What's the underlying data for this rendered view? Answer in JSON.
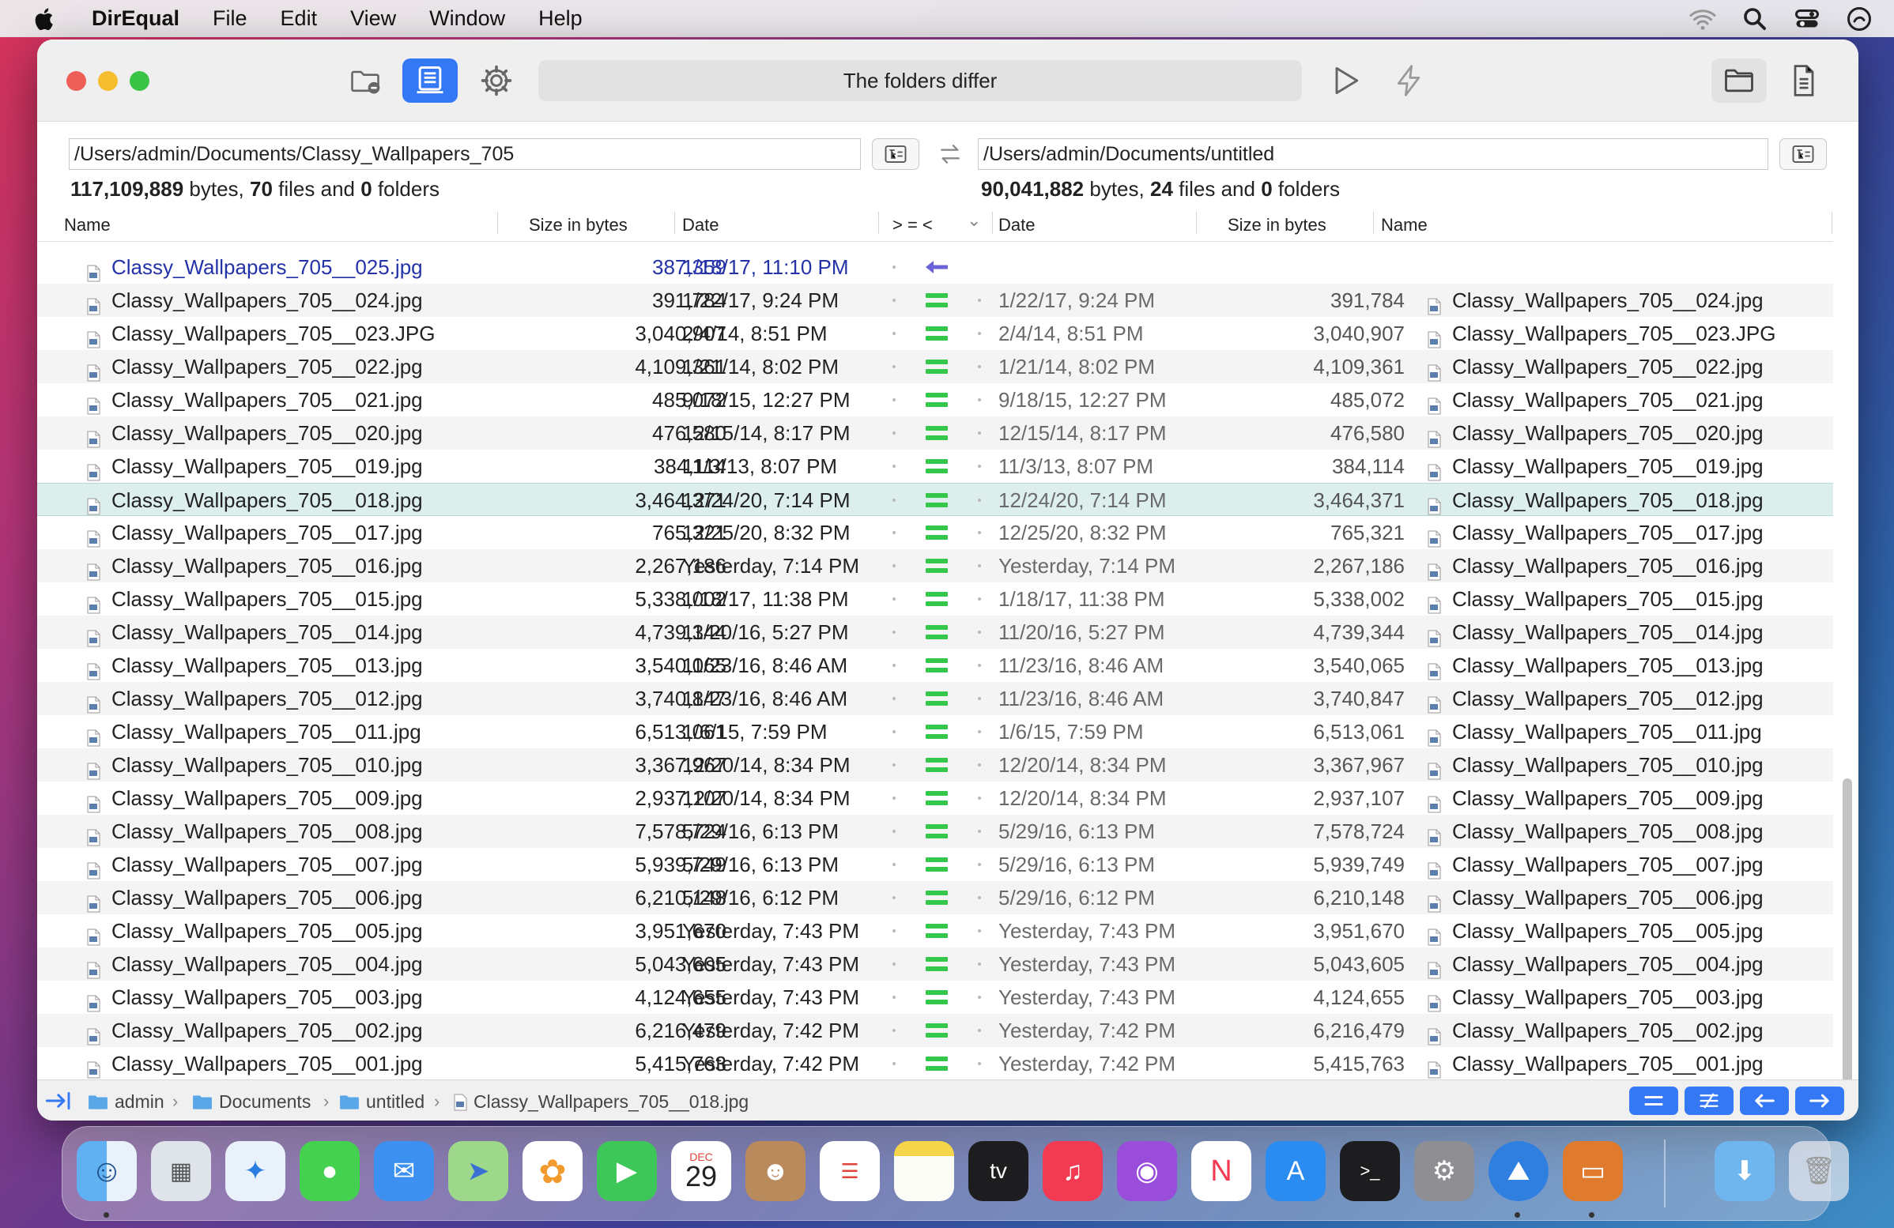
{
  "menubar": {
    "app_name": "DirEqual",
    "items": [
      "File",
      "Edit",
      "View",
      "Window",
      "Help"
    ]
  },
  "toolbar": {
    "status_text": "The folders differ"
  },
  "left": {
    "path": "/Users/admin/Documents/Classy_Wallpapers_705",
    "bytes": "117,109,889",
    "files": "70",
    "folders": "0"
  },
  "right": {
    "path": "/Users/admin/Documents/untitled",
    "bytes": "90,041,882",
    "files": "24",
    "folders": "0"
  },
  "summary_words": {
    "bytes": "bytes,",
    "files_and": "files and",
    "folders": "folders"
  },
  "columns": {
    "name": "Name",
    "size": "Size in bytes",
    "date": "Date",
    "compare": "> = <",
    "rdate": "Date",
    "rsize": "Size in bytes",
    "rname": "Name"
  },
  "rows": [
    {
      "name": "Classy_Wallpapers_705__025.jpg",
      "size": "387,359",
      "date": "1/18/17, 11:10 PM",
      "status": "left-only",
      "rdate": "",
      "rsize": "",
      "rname": ""
    },
    {
      "name": "Classy_Wallpapers_705__024.jpg",
      "size": "391,784",
      "date": "1/22/17, 9:24 PM",
      "status": "equal",
      "rdate": "1/22/17, 9:24 PM",
      "rsize": "391,784",
      "rname": "Classy_Wallpapers_705__024.jpg"
    },
    {
      "name": "Classy_Wallpapers_705__023.JPG",
      "size": "3,040,907",
      "date": "2/4/14, 8:51 PM",
      "status": "equal",
      "rdate": "2/4/14, 8:51 PM",
      "rsize": "3,040,907",
      "rname": "Classy_Wallpapers_705__023.JPG"
    },
    {
      "name": "Classy_Wallpapers_705__022.jpg",
      "size": "4,109,361",
      "date": "1/21/14, 8:02 PM",
      "status": "equal",
      "rdate": "1/21/14, 8:02 PM",
      "rsize": "4,109,361",
      "rname": "Classy_Wallpapers_705__022.jpg"
    },
    {
      "name": "Classy_Wallpapers_705__021.jpg",
      "size": "485,072",
      "date": "9/18/15, 12:27 PM",
      "status": "equal",
      "rdate": "9/18/15, 12:27 PM",
      "rsize": "485,072",
      "rname": "Classy_Wallpapers_705__021.jpg"
    },
    {
      "name": "Classy_Wallpapers_705__020.jpg",
      "size": "476,580",
      "date": "12/15/14, 8:17 PM",
      "status": "equal",
      "rdate": "12/15/14, 8:17 PM",
      "rsize": "476,580",
      "rname": "Classy_Wallpapers_705__020.jpg"
    },
    {
      "name": "Classy_Wallpapers_705__019.jpg",
      "size": "384,114",
      "date": "11/3/13, 8:07 PM",
      "status": "equal",
      "rdate": "11/3/13, 8:07 PM",
      "rsize": "384,114",
      "rname": "Classy_Wallpapers_705__019.jpg"
    },
    {
      "name": "Classy_Wallpapers_705__018.jpg",
      "size": "3,464,371",
      "date": "12/24/20, 7:14 PM",
      "status": "equal",
      "rdate": "12/24/20, 7:14 PM",
      "rsize": "3,464,371",
      "rname": "Classy_Wallpapers_705__018.jpg"
    },
    {
      "name": "Classy_Wallpapers_705__017.jpg",
      "size": "765,321",
      "date": "12/25/20, 8:32 PM",
      "status": "equal",
      "rdate": "12/25/20, 8:32 PM",
      "rsize": "765,321",
      "rname": "Classy_Wallpapers_705__017.jpg"
    },
    {
      "name": "Classy_Wallpapers_705__016.jpg",
      "size": "2,267,186",
      "date": "Yesterday, 7:14 PM",
      "status": "equal",
      "rdate": "Yesterday, 7:14 PM",
      "rsize": "2,267,186",
      "rname": "Classy_Wallpapers_705__016.jpg"
    },
    {
      "name": "Classy_Wallpapers_705__015.jpg",
      "size": "5,338,002",
      "date": "1/18/17, 11:38 PM",
      "status": "equal",
      "rdate": "1/18/17, 11:38 PM",
      "rsize": "5,338,002",
      "rname": "Classy_Wallpapers_705__015.jpg"
    },
    {
      "name": "Classy_Wallpapers_705__014.jpg",
      "size": "4,739,344",
      "date": "11/20/16, 5:27 PM",
      "status": "equal",
      "rdate": "11/20/16, 5:27 PM",
      "rsize": "4,739,344",
      "rname": "Classy_Wallpapers_705__014.jpg"
    },
    {
      "name": "Classy_Wallpapers_705__013.jpg",
      "size": "3,540,065",
      "date": "11/23/16, 8:46 AM",
      "status": "equal",
      "rdate": "11/23/16, 8:46 AM",
      "rsize": "3,540,065",
      "rname": "Classy_Wallpapers_705__013.jpg"
    },
    {
      "name": "Classy_Wallpapers_705__012.jpg",
      "size": "3,740,847",
      "date": "11/23/16, 8:46 AM",
      "status": "equal",
      "rdate": "11/23/16, 8:46 AM",
      "rsize": "3,740,847",
      "rname": "Classy_Wallpapers_705__012.jpg"
    },
    {
      "name": "Classy_Wallpapers_705__011.jpg",
      "size": "6,513,061",
      "date": "1/6/15, 7:59 PM",
      "status": "equal",
      "rdate": "1/6/15, 7:59 PM",
      "rsize": "6,513,061",
      "rname": "Classy_Wallpapers_705__011.jpg"
    },
    {
      "name": "Classy_Wallpapers_705__010.jpg",
      "size": "3,367,967",
      "date": "12/20/14, 8:34 PM",
      "status": "equal",
      "rdate": "12/20/14, 8:34 PM",
      "rsize": "3,367,967",
      "rname": "Classy_Wallpapers_705__010.jpg"
    },
    {
      "name": "Classy_Wallpapers_705__009.jpg",
      "size": "2,937,107",
      "date": "12/20/14, 8:34 PM",
      "status": "equal",
      "rdate": "12/20/14, 8:34 PM",
      "rsize": "2,937,107",
      "rname": "Classy_Wallpapers_705__009.jpg"
    },
    {
      "name": "Classy_Wallpapers_705__008.jpg",
      "size": "7,578,724",
      "date": "5/29/16, 6:13 PM",
      "status": "equal",
      "rdate": "5/29/16, 6:13 PM",
      "rsize": "7,578,724",
      "rname": "Classy_Wallpapers_705__008.jpg"
    },
    {
      "name": "Classy_Wallpapers_705__007.jpg",
      "size": "5,939,749",
      "date": "5/29/16, 6:13 PM",
      "status": "equal",
      "rdate": "5/29/16, 6:13 PM",
      "rsize": "5,939,749",
      "rname": "Classy_Wallpapers_705__007.jpg"
    },
    {
      "name": "Classy_Wallpapers_705__006.jpg",
      "size": "6,210,148",
      "date": "5/29/16, 6:12 PM",
      "status": "equal",
      "rdate": "5/29/16, 6:12 PM",
      "rsize": "6,210,148",
      "rname": "Classy_Wallpapers_705__006.jpg"
    },
    {
      "name": "Classy_Wallpapers_705__005.jpg",
      "size": "3,951,670",
      "date": "Yesterday, 7:43 PM",
      "status": "equal",
      "rdate": "Yesterday, 7:43 PM",
      "rsize": "3,951,670",
      "rname": "Classy_Wallpapers_705__005.jpg"
    },
    {
      "name": "Classy_Wallpapers_705__004.jpg",
      "size": "5,043,605",
      "date": "Yesterday, 7:43 PM",
      "status": "equal",
      "rdate": "Yesterday, 7:43 PM",
      "rsize": "5,043,605",
      "rname": "Classy_Wallpapers_705__004.jpg"
    },
    {
      "name": "Classy_Wallpapers_705__003.jpg",
      "size": "4,124,655",
      "date": "Yesterday, 7:43 PM",
      "status": "equal",
      "rdate": "Yesterday, 7:43 PM",
      "rsize": "4,124,655",
      "rname": "Classy_Wallpapers_705__003.jpg"
    },
    {
      "name": "Classy_Wallpapers_705__002.jpg",
      "size": "6,216,479",
      "date": "Yesterday, 7:42 PM",
      "status": "equal",
      "rdate": "Yesterday, 7:42 PM",
      "rsize": "6,216,479",
      "rname": "Classy_Wallpapers_705__002.jpg"
    },
    {
      "name": "Classy_Wallpapers_705__001.jpg",
      "size": "5,415,763",
      "date": "Yesterday, 7:42 PM",
      "status": "equal",
      "rdate": "Yesterday, 7:42 PM",
      "rsize": "5,415,763",
      "rname": "Classy_Wallpapers_705__001.jpg"
    }
  ],
  "selected_row": 7,
  "breadcrumb": [
    "admin",
    "Documents",
    "untitled",
    "Classy_Wallpapers_705__018.jpg"
  ],
  "dock": {
    "calendar_month": "DEC",
    "calendar_day": "29",
    "tv_label": "tv",
    "apps": [
      "finder-icon",
      "launchpad-icon",
      "safari-icon",
      "messages-icon",
      "mail-icon",
      "maps-icon",
      "photos-icon",
      "facetime-icon",
      "calendar-icon",
      "contacts-icon",
      "reminders-icon",
      "notes-icon",
      "apple-tv-icon",
      "music-icon",
      "podcasts-icon",
      "news-icon",
      "app-store-icon",
      "terminal-icon",
      "system-preferences-icon",
      "direqual-icon",
      "keynote-icon",
      "downloads-icon",
      "trash-icon"
    ]
  },
  "colors": {
    "accent": "#3478f6",
    "equal": "#33c84a",
    "left_only": "#2432a8",
    "selected_row": "#dcefed"
  }
}
